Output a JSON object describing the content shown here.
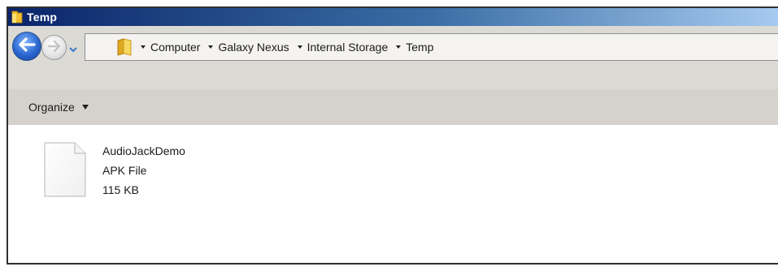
{
  "window": {
    "title": "Temp"
  },
  "navigation": {
    "breadcrumbs": [
      "Computer",
      "Galaxy Nexus",
      "Internal Storage",
      "Temp"
    ]
  },
  "toolbar": {
    "organize_label": "Organize"
  },
  "files": [
    {
      "name": "AudioJackDemo",
      "type": "APK File",
      "size": "115 KB",
      "icon": "generic-file-icon"
    }
  ],
  "icons": {
    "title": "folder-icon",
    "back": "back-arrow-icon",
    "forward": "forward-arrow-icon",
    "history": "chevron-down-icon",
    "address": "folder-icon"
  },
  "colors": {
    "titlebar_start": "#0a246a",
    "titlebar_end": "#a6caf0",
    "nav_background": "#dcdad5",
    "toolbar_background": "#d5d2cc",
    "back_button": "#2a67d0"
  }
}
